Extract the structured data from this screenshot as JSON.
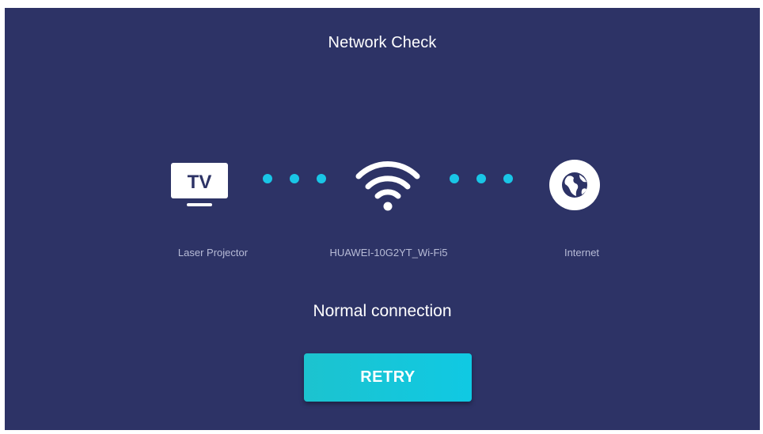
{
  "header": {
    "title": "Network Check"
  },
  "nodes": {
    "projector": {
      "icon": "tv-icon",
      "icon_text": "TV",
      "label": "Laser Projector"
    },
    "wifi": {
      "icon": "wifi-icon",
      "label": "HUAWEI-10G2YT_Wi-Fi5"
    },
    "internet": {
      "icon": "globe-icon",
      "label": "Internet"
    }
  },
  "status": {
    "text": "Normal connection"
  },
  "actions": {
    "retry_label": "RETRY"
  },
  "colors": {
    "background": "#2d3366",
    "accent": "#19c6e6",
    "label": "#b7bbd6",
    "text": "#ffffff"
  }
}
